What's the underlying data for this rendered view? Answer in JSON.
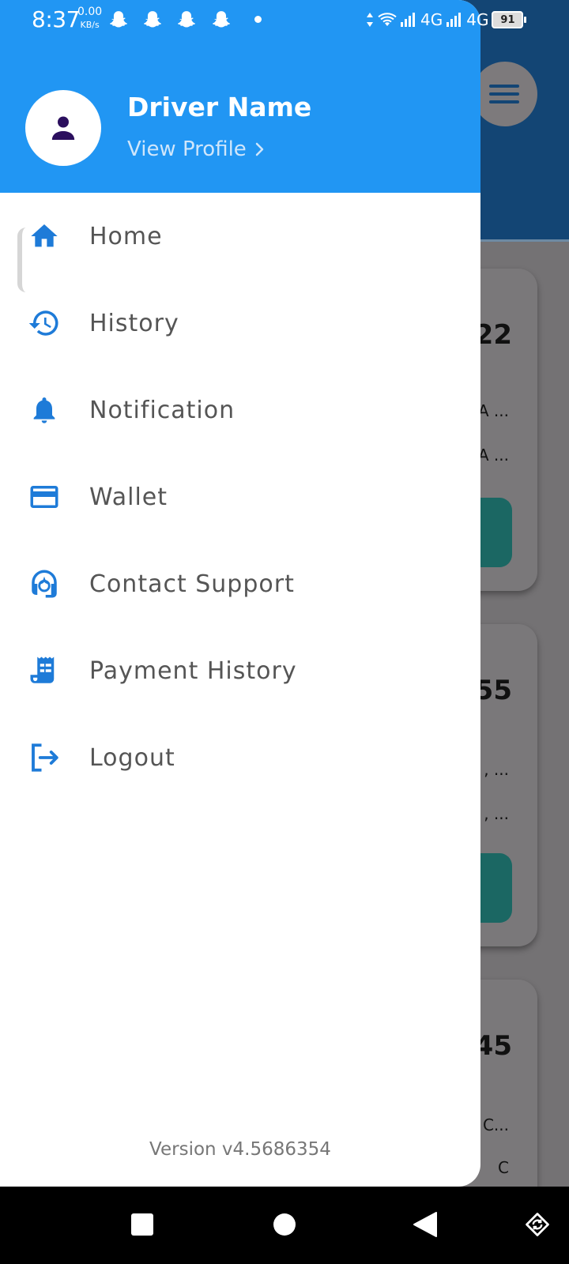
{
  "status_bar": {
    "time": "8:37",
    "net_speed_value": "0.00",
    "net_speed_unit": "KB/s",
    "network_1": "4G",
    "network_2": "4G",
    "battery": "91"
  },
  "background": {
    "cards": [
      {
        "number": "22",
        "line1": "A ...",
        "line2": "A ..."
      },
      {
        "number": "55",
        "line1": ", ...",
        "line2": ", ..."
      },
      {
        "number": "45",
        "line1": "C...",
        "line2": "C"
      }
    ]
  },
  "drawer": {
    "profile": {
      "name": "Driver Name",
      "view_profile": "View Profile"
    },
    "menu": [
      {
        "label": "Home",
        "icon": "home-icon"
      },
      {
        "label": "History",
        "icon": "history-icon"
      },
      {
        "label": "Notification",
        "icon": "bell-icon"
      },
      {
        "label": "Wallet",
        "icon": "credit-card-icon"
      },
      {
        "label": "Contact Support",
        "icon": "headset-icon"
      },
      {
        "label": "Payment History",
        "icon": "receipt-icon"
      },
      {
        "label": "Logout",
        "icon": "logout-icon"
      }
    ],
    "version": "Version v4.5686354"
  },
  "colors": {
    "header_blue": "#2196f3",
    "icon_blue": "#1e7bd8",
    "background_header": "#134574",
    "avatar_icon": "#2b0f5e"
  }
}
